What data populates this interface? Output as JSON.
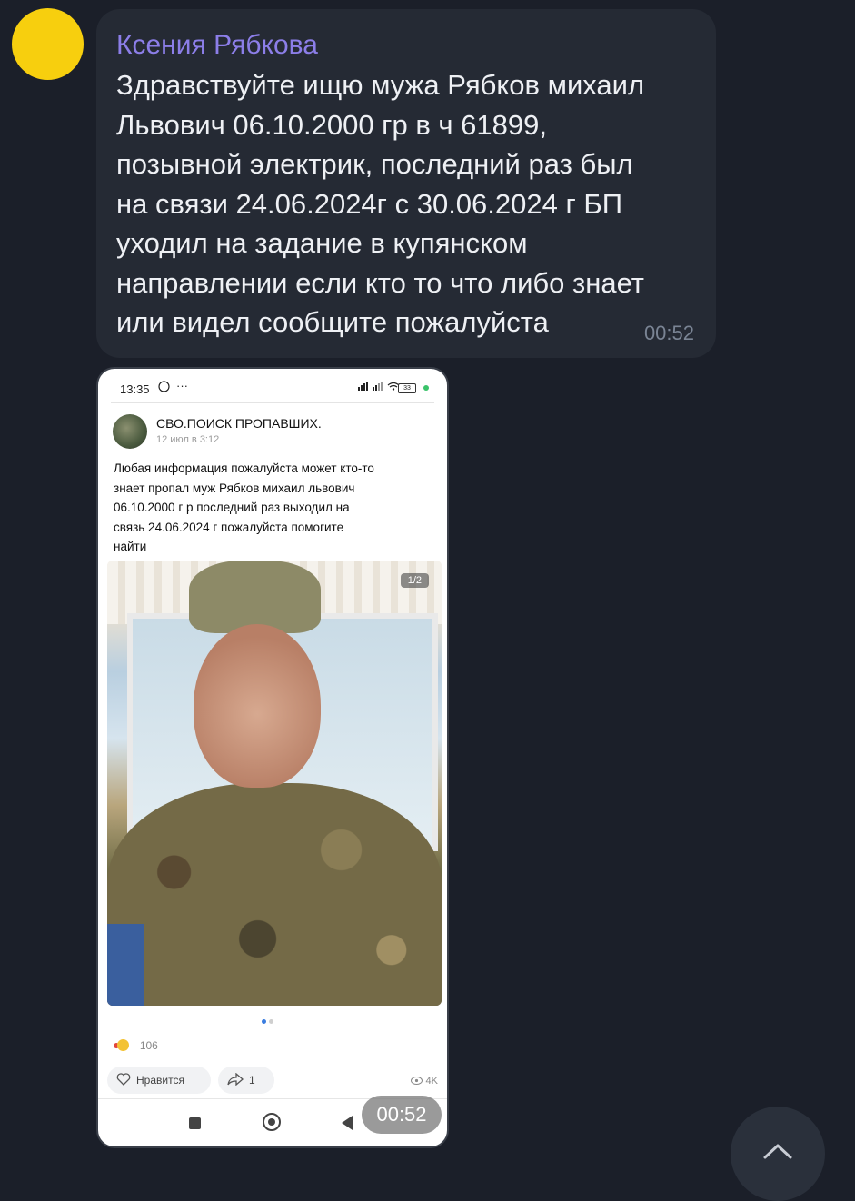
{
  "chat": {
    "message": {
      "sender": "Ксения Рябкова",
      "text": "Здравствуйте ищю мужа Рябков михаил\nЛьвович 06.10.2000 гр в ч 61899,\nпозывной электрик, последний раз был\nна связи 24.06.2024г с 30.06.2024 г БП\nуходил  на задание в купянском\nнаправлении если кто то что либо знает\nили видел сообщите пожалуйста",
      "time": "00:52",
      "sender_color": "#8c7ee8",
      "avatar_color": "#f7cf0e"
    },
    "media": {
      "time": "00:52",
      "phone": {
        "status_time": "13:35",
        "status_dots": "···",
        "battery": "33",
        "post": {
          "author": "СВО.ПОИСК ПРОПАВШИХ.",
          "date": "12 июл в 3:12",
          "text": "Любая информация пожалуйста может кто-то\nзнает пропал муж Рябков михаил львович\n06.10.2000 г р последний раз выходил на\nсвязь 24.06.2024 г пожалуйста помогите\nнайти",
          "photo_counter": "1/2",
          "reactions_count": "106",
          "like_label": "Нравится",
          "share_count": "1",
          "views": "4K"
        }
      }
    }
  },
  "icons": {
    "scroll_down": "chevron-up-icon",
    "like": "heart-outline-icon",
    "share": "share-arrow-icon",
    "views": "eye-icon"
  }
}
